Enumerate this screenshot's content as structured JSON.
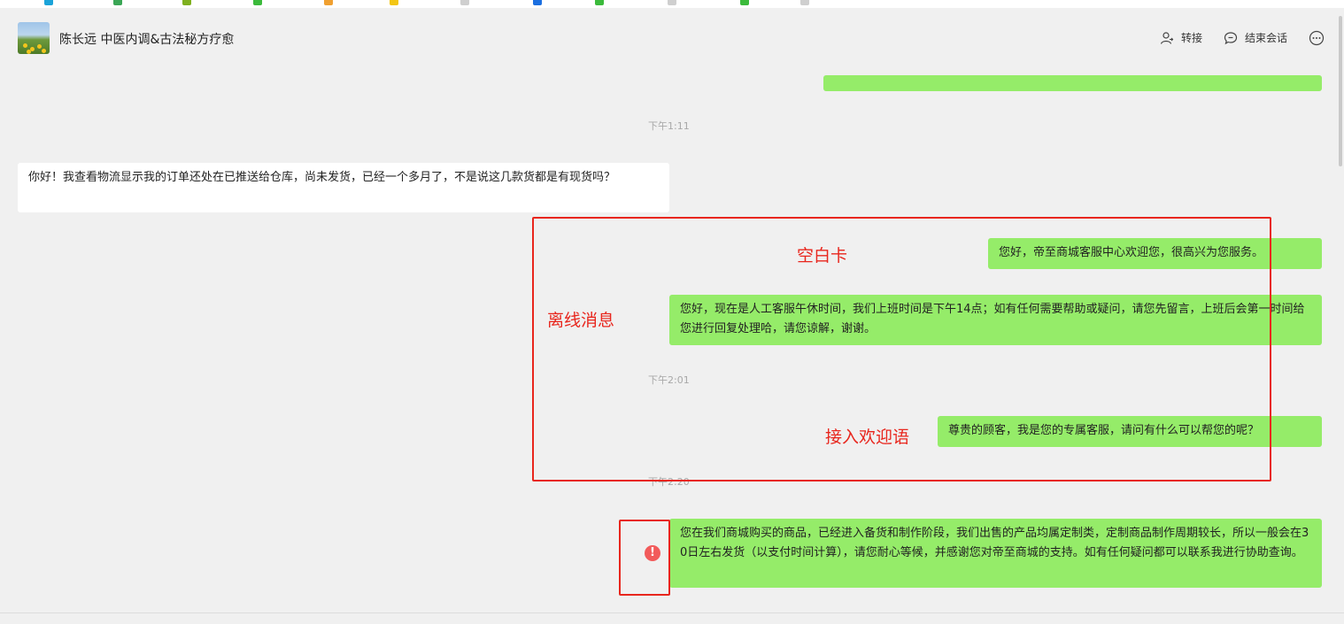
{
  "conversation": {
    "title": "陈长远 中医内调&古法秘方疗愈"
  },
  "header_actions": {
    "transfer": {
      "label": "转接",
      "icon": "person-icon"
    },
    "end_session": {
      "label": "结束会话",
      "icon": "chat-minus-icon"
    },
    "more": {
      "icon": "ellipsis-icon"
    }
  },
  "messages": {
    "t1": "下午1:11",
    "customer_1": "你好！我查看物流显示我的订单还处在已推送给仓库，尚未发货，已经一个多月了，不是说这几款货都是有现货吗？",
    "agent_1": "您好，帝至商城客服中心欢迎您，很高兴为您服务。",
    "agent_2": "您好，现在是人工客服午休时间，我们上班时间是下午14点；如有任何需要帮助或疑问，请您先留言，上班后会第一时间给您进行回复处理哈，请您谅解，谢谢。",
    "t2": "下午2:01",
    "agent_3": "尊贵的顾客，我是您的专属客服，请问有什么可以帮您的呢？",
    "t3": "下午2:20",
    "agent_4": "您在我们商城购买的商品，已经进入备货和制作阶段，我们出售的产品均属定制类，定制商品制作周期较长，所以一般会在30日左右发货（以支付时间计算），请您耐心等候，并感谢您对帝至商城的支持。如有任何疑问都可以联系我进行协助查询。"
  },
  "annotations": {
    "blank_card": "空白卡",
    "offline_message": "离线消息",
    "welcome_message": "接入欢迎语",
    "error_mark": "!"
  },
  "colors": {
    "agent_bubble": "#95ec69",
    "customer_bubble": "#ffffff",
    "annotation": "#e8261d",
    "error": "#f25a5a",
    "background": "#f0f0f0"
  }
}
